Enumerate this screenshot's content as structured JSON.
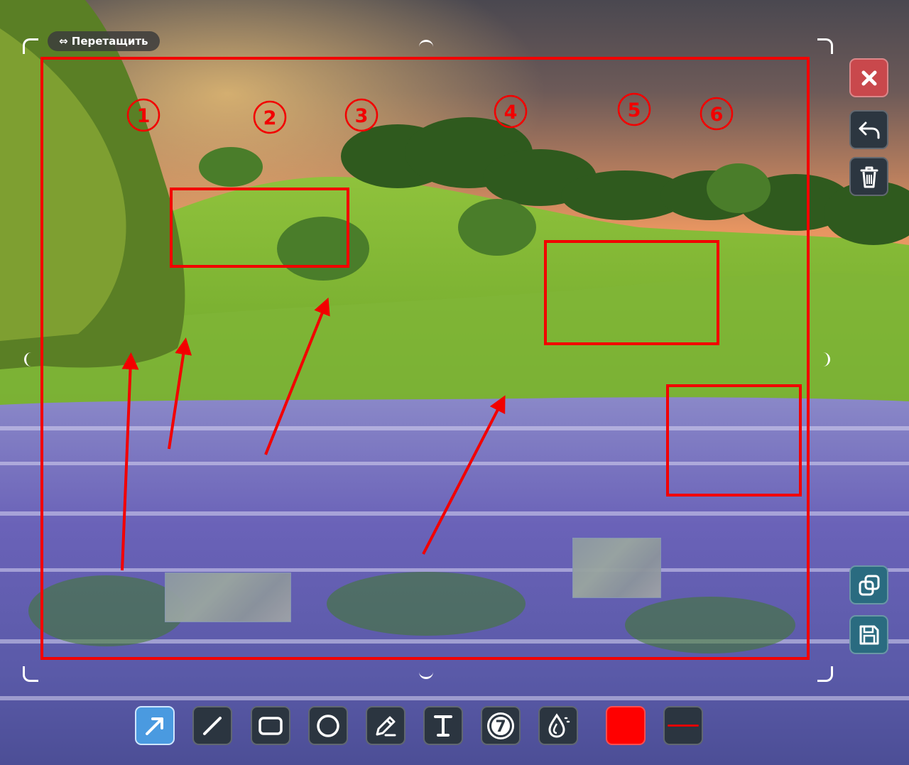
{
  "drag_handle": {
    "label": "⇔ Перетащить"
  },
  "markers": [
    {
      "label": "1"
    },
    {
      "label": "2"
    },
    {
      "label": "3"
    },
    {
      "label": "4"
    },
    {
      "label": "5"
    },
    {
      "label": "6"
    }
  ],
  "side_buttons": [
    {
      "icon": "close-icon"
    },
    {
      "icon": "undo-icon"
    },
    {
      "icon": "trash-icon"
    },
    {
      "icon": "copy-icon"
    },
    {
      "icon": "save-icon"
    }
  ],
  "toolbar": {
    "tools": [
      {
        "icon": "arrow-tool-icon",
        "active": true
      },
      {
        "icon": "line-tool-icon"
      },
      {
        "icon": "rectangle-tool-icon"
      },
      {
        "icon": "circle-tool-icon"
      },
      {
        "icon": "pencil-tool-icon"
      },
      {
        "icon": "text-tool-icon"
      },
      {
        "icon": "counter-tool-icon",
        "label": "7"
      },
      {
        "icon": "blur-tool-icon"
      }
    ],
    "color": "#ff0000",
    "line_color": "#e60000"
  },
  "colors": {
    "annotation": "#f20000",
    "toolbar_button": "#2b3540",
    "active_tool": "#4a9ae0",
    "close_button": "#c9484c",
    "copy_save_button": "#2a6b80"
  }
}
